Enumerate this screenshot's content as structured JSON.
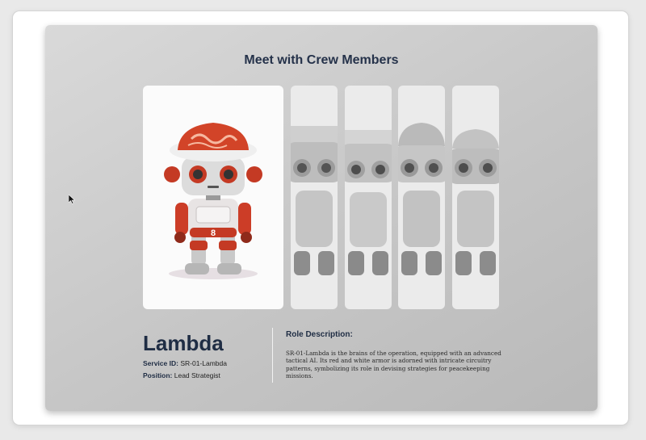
{
  "page": {
    "title": "Meet with Crew Members"
  },
  "crew": {
    "selected": {
      "name": "Lambda",
      "service_id_label": "Service ID:",
      "service_id": "SR-01-Lambda",
      "position_label": "Position:",
      "position": "Lead Strategist",
      "role_heading": "Role Description:",
      "role_text": "SR-01-Lambda is the brains of the operation, equipped with an advanced tactical AI. Its red and white armor is adorned with intricate circuitry patterns, symbolizing its role in devising strategies for peacekeeping missions."
    }
  },
  "colors": {
    "accent": "#d0402a",
    "heading": "#1f2d44",
    "panel": "#c9c9c9"
  },
  "icons": {
    "cursor": "cursor-arrow-icon"
  }
}
